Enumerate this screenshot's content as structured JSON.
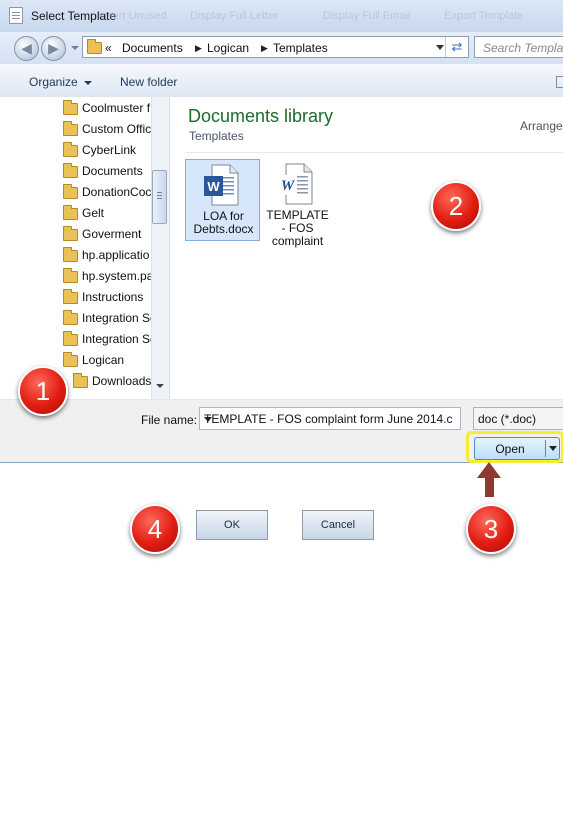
{
  "dialog": {
    "title": "Select Template",
    "ghost_labels": [
      "Insert Unused",
      "Display Full Letter",
      "Display Full Email",
      "Export Template"
    ]
  },
  "address_bar": {
    "prefix": "«",
    "crumbs": [
      "Documents",
      "Logican",
      "Templates"
    ],
    "search_placeholder": "Search Templat"
  },
  "command_bar": {
    "organize": "Organize",
    "new_folder": "New folder"
  },
  "nav_pane": {
    "items": [
      "Coolmuster f",
      "Custom Offic",
      "CyberLink",
      "Documents",
      "DonationCoc",
      "Gelt",
      "Goverment",
      "hp.applicatio",
      "hp.system.pa",
      "Instructions",
      "Integration Sc",
      "Integration Sc",
      "Logican"
    ],
    "subitem": "Downloads"
  },
  "content": {
    "library_title": "Documents library",
    "library_subtitle": "Templates",
    "arrange_label": "Arrange",
    "files": [
      {
        "name_line1": "LOA for",
        "name_line2": "Debts.docx",
        "name_line3": "",
        "selected": true
      },
      {
        "name_line1": "TEMPLATE",
        "name_line2": "- FOS",
        "name_line3": "complaint",
        "selected": false
      }
    ]
  },
  "bottom": {
    "file_name_label": "File name:",
    "file_name_value": "TEMPLATE - FOS complaint form June 2014.c",
    "file_type_value": "doc (*.doc)",
    "open_label": "Open"
  },
  "form_buttons": {
    "ok_label": "OK",
    "cancel_label": "Cancel"
  },
  "callouts": [
    "1",
    "2",
    "3",
    "4"
  ],
  "colors": {
    "callout": "#e11d12",
    "highlight": "#f3ee2e",
    "library_title": "#1f6a2c",
    "arrow": "#8f3a30"
  }
}
